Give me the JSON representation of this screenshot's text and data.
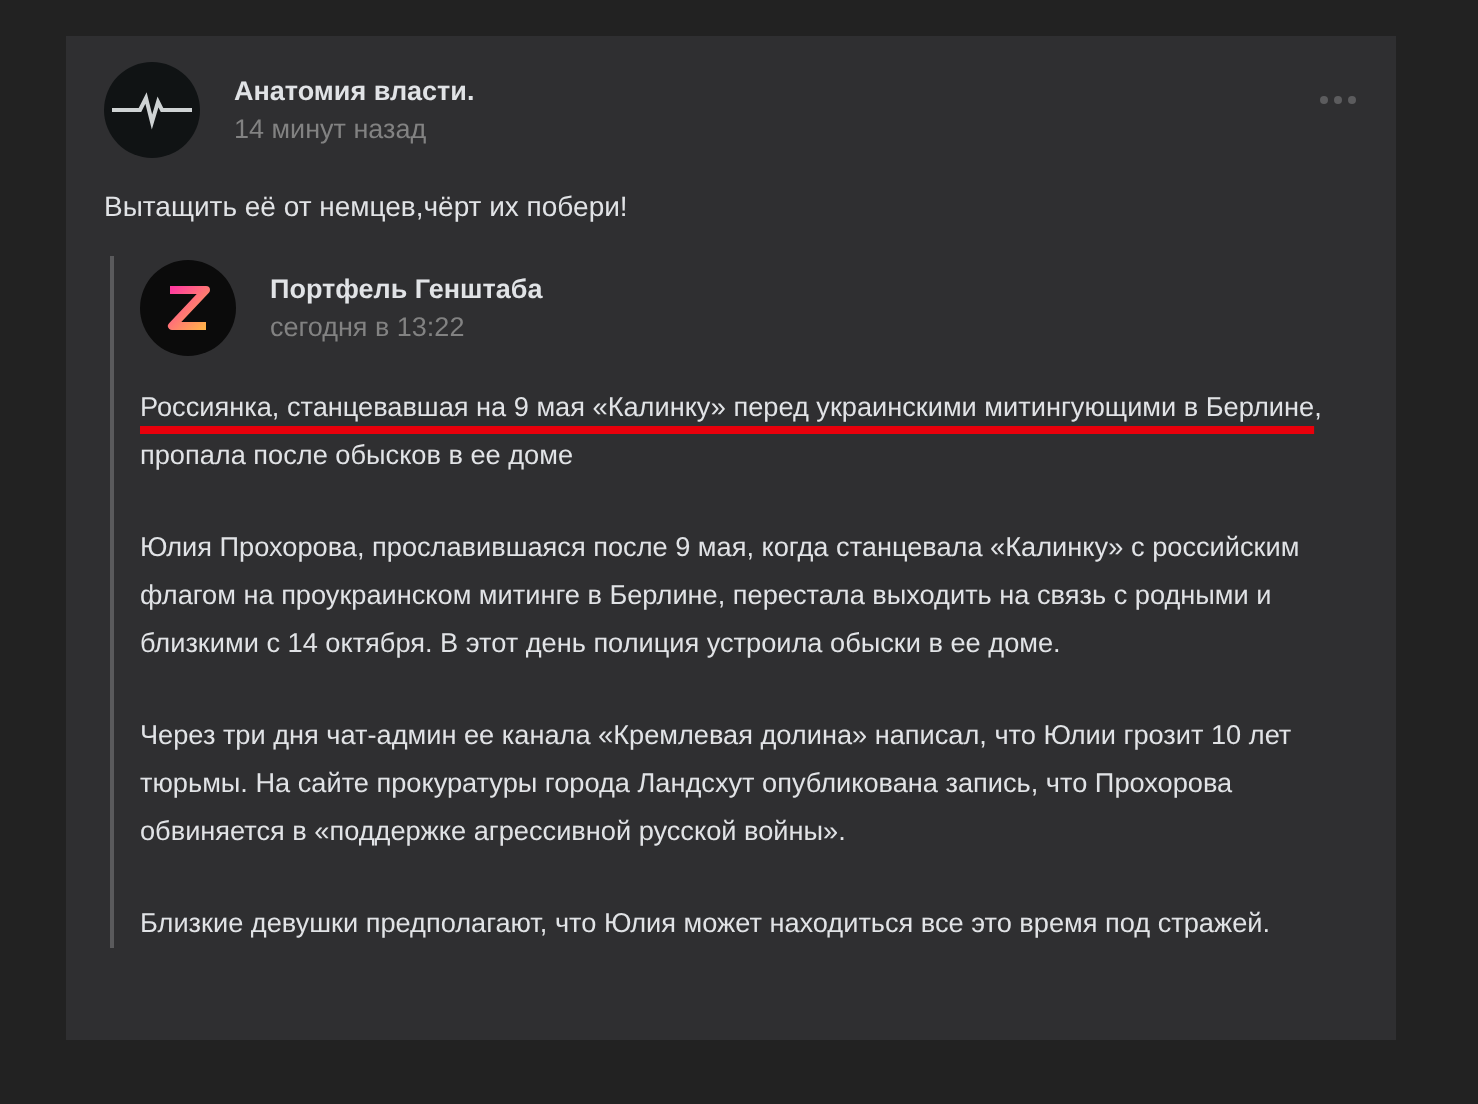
{
  "post": {
    "author": "Анатомия власти.",
    "time": "14 минут назад",
    "text": "Вытащить её от немцев,чёрт их побери!",
    "repost": {
      "author": "Портфель Генштаба",
      "time": "сегодня в 13:22",
      "paragraphs": [
        {
          "highlight": "Россиянка, станцевавшая на 9 мая «Калинку» перед украинскими митингующими в Берлине",
          "rest": ", пропала после обысков в ее доме"
        },
        {
          "text": "Юлия Прохорова, прославившаяся после 9 мая, когда станцевала «Калинку» с российским флагом на проукраинском митинге в Берлине, перестала выходить на связь с родными и близкими с 14 октября. В этот день полиция устроила обыски в ее доме."
        },
        {
          "text": "Через три дня чат-админ ее канала «Кремлевая долина» написал, что Юлии грозит 10 лет тюрьмы. На сайте прокуратуры города Ландсхут опубликована запись, что Прохорова обвиняется в «поддержке агрессивной русской войны»."
        },
        {
          "text": "Близкие девушки предполагают, что Юлия может находиться все это время под стражей."
        }
      ]
    }
  }
}
